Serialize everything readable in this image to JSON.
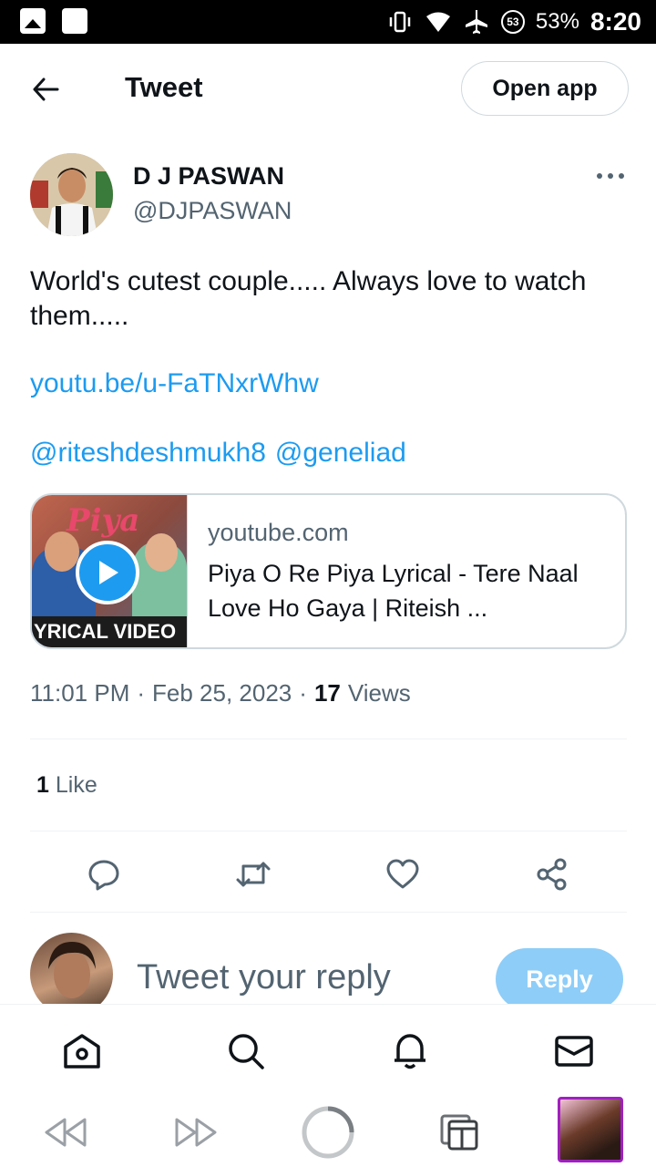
{
  "status_bar": {
    "badge": "53",
    "battery": "53%",
    "time": "8:20"
  },
  "header": {
    "title": "Tweet",
    "open_app_label": "Open app"
  },
  "author": {
    "name": "D J PASWAN",
    "handle": "@DJPASWAN"
  },
  "tweet": {
    "text": "World's cutest couple..... Always love to watch them.....",
    "link": "youtu.be/u-FaTNxrWhw",
    "mentions": [
      "@riteshdeshmukh8",
      "@geneliad"
    ]
  },
  "card": {
    "thumb_title": "Piya",
    "thumb_caption": "YRICAL VIDEO",
    "domain": "youtube.com",
    "title": "Piya O Re Piya Lyrical - Tere Naal Love Ho Gaya | Riteish ..."
  },
  "meta": {
    "time": "11:01 PM",
    "sep1": "·",
    "date": "Feb 25, 2023",
    "sep2": "·",
    "views_count": "17",
    "views_label": "Views"
  },
  "engagement": {
    "likes_count": "1",
    "likes_label": "Like"
  },
  "actions": [
    "reply-icon",
    "retweet-icon",
    "like-icon",
    "share-icon"
  ],
  "reply_bar": {
    "placeholder": "Tweet your reply",
    "button_label": "Reply"
  },
  "bottom_nav": [
    "home-icon",
    "search-icon",
    "notifications-icon",
    "messages-icon"
  ],
  "system_nav": [
    "back-icon",
    "forward-icon",
    "home-circle-icon",
    "tabs-icon",
    "profile-thumb"
  ],
  "colors": {
    "accent": "#1d9bf0",
    "reply_disabled": "#8ecdf8",
    "text_secondary": "#536471",
    "border": "#cfd9de"
  }
}
